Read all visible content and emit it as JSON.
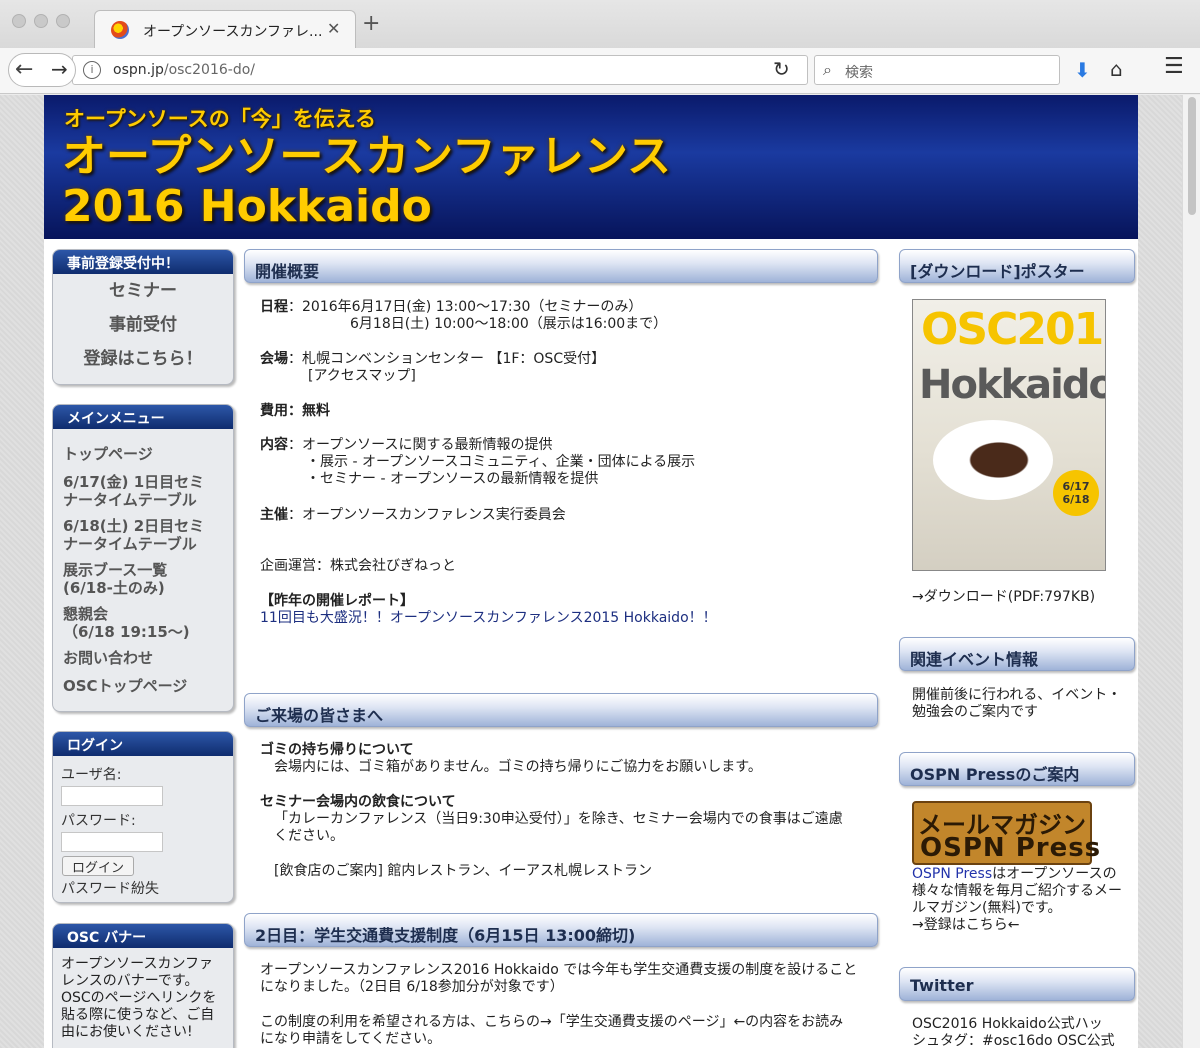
{
  "browser": {
    "tab_title": "オープンソースカンファレ...",
    "tab_close": "✕",
    "new_tab": "+",
    "url_host": "ospn.jp",
    "url_path": "/osc2016-do/",
    "search_placeholder": "検索"
  },
  "banner": {
    "subtitle": "オープンソースの「今」を伝える",
    "title_line1": "オープンソースカンファレンス",
    "title_line2": "2016 Hokkaido"
  },
  "sidebar": {
    "register": {
      "heading": "事前登録受付中！",
      "lines": [
        "セミナー",
        "事前受付",
        "登録はこちら！"
      ]
    },
    "main_menu": {
      "heading": "メインメニュー",
      "items": [
        [
          "トップページ"
        ],
        [
          "6/17(金) 1日目セミ",
          "ナータイムテーブル"
        ],
        [
          "6/18(土) 2日目セミ",
          "ナータイムテーブル"
        ],
        [
          "展示ブース一覧",
          "(6/18-土のみ)"
        ],
        [
          "懇親会",
          "（6/18 19:15〜)"
        ],
        [
          "お問い合わせ"
        ],
        [
          "OSCトップページ"
        ]
      ]
    },
    "login": {
      "heading": "ログイン",
      "user_label": "ユーザ名:",
      "password_label": "パスワード:",
      "button": "ログイン",
      "forgot": "パスワード紛失"
    },
    "banner_box": {
      "heading": "OSC バナー",
      "lines": [
        "オープンソースカンファ",
        "レンスのバナーです。",
        "OSCのページへリンクを",
        "貼る際に使うなど、ご自",
        "由にお使いください!"
      ]
    }
  },
  "main": {
    "overview": {
      "heading": "開催概要",
      "date_label": "日程",
      "date_line1": "：2016年6月17日(金) 13:00〜17:30（セミナーのみ）",
      "date_line2": "6月18日(土) 10:00〜18:00（展示は16:00まで）",
      "venue_label": "会場",
      "venue_text": "：札幌コンベンションセンター 【1F：OSC受付】",
      "venue_map": "[アクセスマップ]",
      "fee_label": "費用",
      "fee_text": "：無料",
      "content_label": "内容",
      "content_text": "：オープンソースに関する最新情報の提供",
      "content_items": [
        "・展示 - オープンソースコミュニティ、企業・団体による展示",
        "・セミナー - オープンソースの最新情報を提供"
      ],
      "host_label": "主催",
      "host_text": "：オープンソースカンファレンス実行委員会",
      "organizer": "企画運営：株式会社びぎねっと",
      "report_heading": "【昨年の開催レポート】",
      "report_link": "11回目も大盛況！！オープンソースカンファレンス2015 Hokkaido！！"
    },
    "visitors": {
      "heading": "ご来場の皆さまへ",
      "trash_heading": "ゴミの持ち帰りについて",
      "trash_text": "会場内には、ゴミ箱がありません。ゴミの持ち帰りにご協力をお願いします。",
      "food_heading": "セミナー会場内の飲食について",
      "food_line1": "「カレーカンファレンス（当日9:30申込受付）」を除き、セミナー会場内での食事はご遠慮",
      "food_line2": "ください。",
      "restaurant": "[飲食店のご案内] 館内レストラン、イーアス札幌レストラン"
    },
    "support": {
      "heading": "2日目：学生交通費支援制度（6月15日 13:00締切)",
      "line1": "オープンソースカンファレンス2016 Hokkaido では今年も学生交通費支援の制度を設けること",
      "line2": "になりました。（2日目 6/18参加分が対象です）",
      "line3": "この制度の利用を希望される方は、こちらの→「学生交通費支援のページ」←の内容をお読み",
      "line4": "になり申請をしてください。"
    }
  },
  "right": {
    "poster": {
      "heading": "[ダウンロード]ポスター",
      "download": "→ダウンロード(PDF:797KB)"
    },
    "related": {
      "heading": "関連イベント情報",
      "line1": "開催前後に行われる、イベント・",
      "line2": "勉強会のご案内です"
    },
    "press": {
      "heading": "OSPN Pressのご案内",
      "logo_line1": "メールマガジン",
      "logo_line2": "OSPN Press",
      "link": "OSPN Press",
      "line1_rest": "はオープンソースの",
      "line2": "様々な情報を毎月ご紹介するメー",
      "line3": "ルマガジン(無料)です。",
      "line4": "→登録はこちら←"
    },
    "twitter": {
      "heading": "Twitter",
      "line1": "OSC2016 Hokkaido公式ハッ",
      "line2": "シュタグ：#osc16do OSC公式"
    }
  },
  "colors": {
    "banner_bg": "#0a1a6b",
    "banner_text": "#ffcc00",
    "link": "#2233aa"
  }
}
